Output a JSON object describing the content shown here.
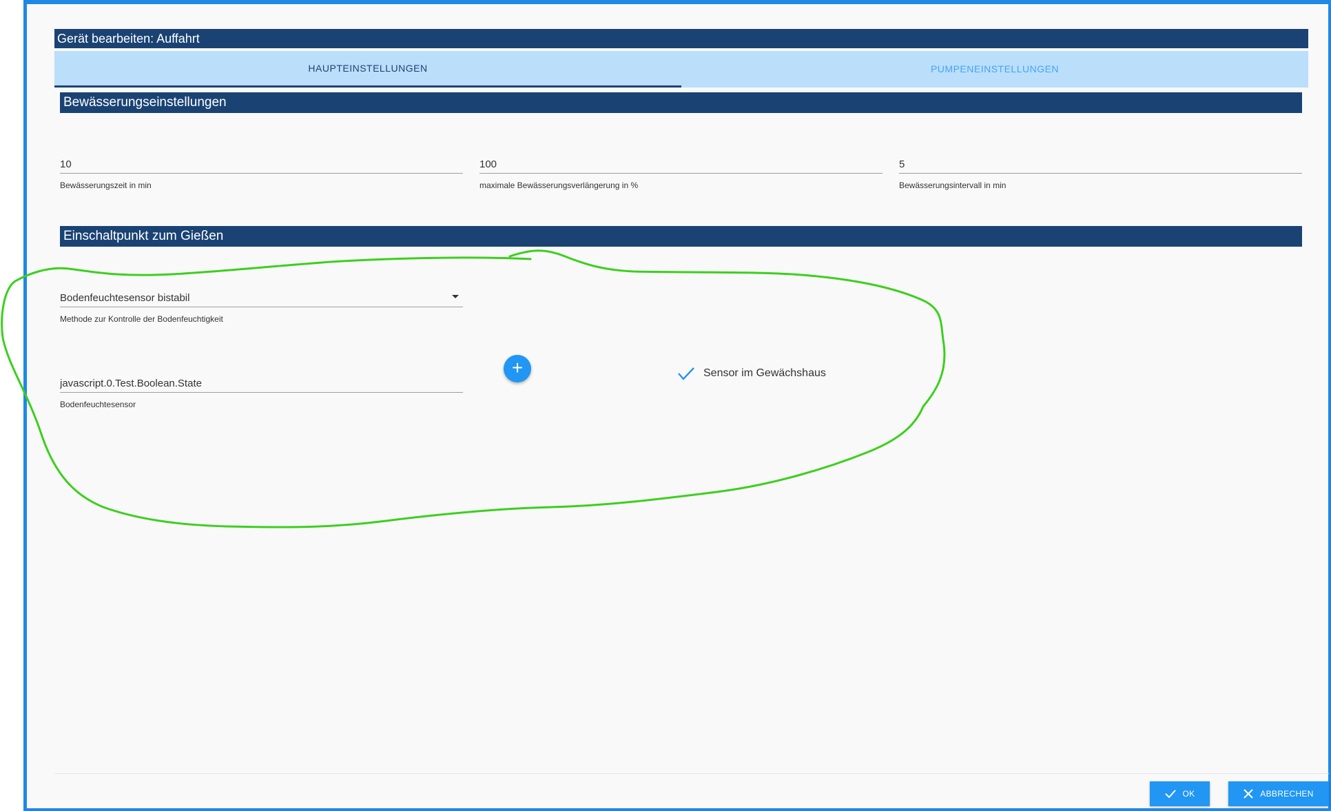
{
  "dialog": {
    "title": "Gerät bearbeiten: Auffahrt"
  },
  "tabs": [
    {
      "label": "HAUPTEINSTELLUNGEN",
      "active": true
    },
    {
      "label": "PUMPENEINSTELLUNGEN",
      "active": false
    }
  ],
  "irrigation": {
    "title": "Bewässerungseinstellungen",
    "fields": [
      {
        "value": "10",
        "label": "Bewässerungszeit in min"
      },
      {
        "value": "100",
        "label": "maximale Bewässerungsverlängerung in %"
      },
      {
        "value": "5",
        "label": "Bewässerungsintervall in min"
      }
    ]
  },
  "trigger": {
    "title": "Einschaltpunkt zum Gießen",
    "method": {
      "value": "Bodenfeuchtesensor bistabil",
      "label": "Methode zur Kontrolle der Bodenfeuchtigkeit"
    },
    "sensor": {
      "value": "javascript.0.Test.Boolean.State",
      "label": "Bodenfeuchtesensor"
    },
    "add_icon": "plus-icon",
    "greenhouse": {
      "label": "Sensor im Gewächshaus",
      "checked": true
    }
  },
  "footer": {
    "ok_label": "OK",
    "cancel_label": "ABBRECHEN"
  },
  "colors": {
    "header_bg": "#1a4373",
    "tab_bg": "#bbdefb",
    "accent": "#2196f3",
    "annotation": "#3ccf1e"
  }
}
